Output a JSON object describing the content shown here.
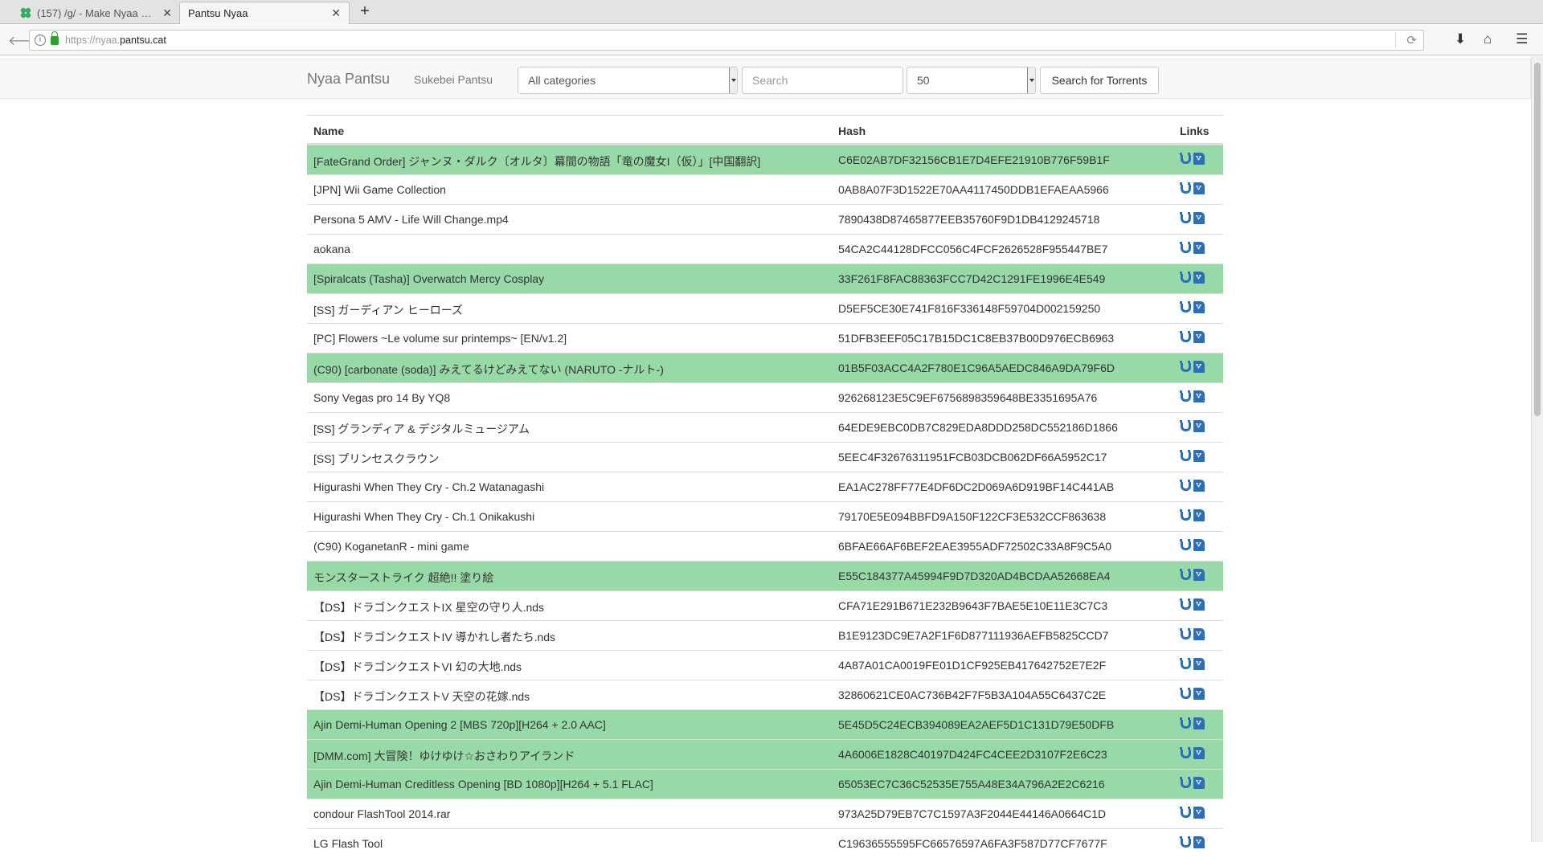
{
  "browser": {
    "tabs": [
      {
        "title": "(157) /g/ - Make Nyaa Great Again",
        "active": false
      },
      {
        "title": "Pantsu Nyaa",
        "active": true
      }
    ],
    "url_scheme": "https://nyaa.",
    "url_host": "pantsu.cat"
  },
  "header": {
    "brand": "Nyaa Pantsu",
    "sukebei_link": "Sukebei Pantsu",
    "category_selected": "All categories",
    "search_placeholder": "Search",
    "per_page_selected": "50",
    "search_button": "Search for Torrents"
  },
  "table": {
    "headers": {
      "name": "Name",
      "hash": "Hash",
      "links": "Links"
    },
    "rows": [
      {
        "name": "[FateGrand Order] ジャンヌ・ダルク〔オルタ〕幕間の物語「竜の魔女I（仮）」[中国翻訳]",
        "hash": "C6E02AB7DF32156CB1E7D4EFE21910B776F59B1F",
        "trusted": true
      },
      {
        "name": "[JPN] Wii Game Collection",
        "hash": "0AB8A07F3D1522E70AA4117450DDB1EFAEAA5966",
        "trusted": false
      },
      {
        "name": "Persona 5 AMV - Life Will Change.mp4",
        "hash": "7890438D87465877EEB35760F9D1DB4129245718",
        "trusted": false
      },
      {
        "name": "aokana",
        "hash": "54CA2C44128DFCC056C4FCF2626528F955447BE7",
        "trusted": false
      },
      {
        "name": "[Spiralcats (Tasha)] Overwatch Mercy Cosplay",
        "hash": "33F261F8FAC88363FCC7D42C1291FE1996E4E549",
        "trusted": true
      },
      {
        "name": "[SS] ガーディアン ヒーローズ",
        "hash": "D5EF5CE30E741F816F336148F59704D002159250",
        "trusted": false
      },
      {
        "name": "[PC] Flowers ~Le volume sur printemps~ [EN/v1.2]",
        "hash": "51DFB3EEF05C17B15DC1C8EB37B00D976ECB6963",
        "trusted": false
      },
      {
        "name": "(C90) [carbonate (soda)] みえてるけどみえてない (NARUTO -ナルト-)",
        "hash": "01B5F03ACC4A2F780E1C96A5AEDC846A9DA79F6D",
        "trusted": true
      },
      {
        "name": "Sony Vegas pro 14 By YQ8",
        "hash": "926268123E5C9EF6756898359648BE3351695A76",
        "trusted": false
      },
      {
        "name": "[SS] グランディア & デジタルミュージアム",
        "hash": "64EDE9EBC0DB7C829EDA8DDD258DC552186D1866",
        "trusted": false
      },
      {
        "name": "[SS] プリンセスクラウン",
        "hash": "5EEC4F32676311951FCB03DCB062DF66A5952C17",
        "trusted": false
      },
      {
        "name": "Higurashi When They Cry - Ch.2 Watanagashi",
        "hash": "EA1AC278FF77E4DF6DC2D069A6D919BF14C441AB",
        "trusted": false
      },
      {
        "name": "Higurashi When They Cry - Ch.1 Onikakushi",
        "hash": "79170E5E094BBFD9A150F122CF3E532CCF863638",
        "trusted": false
      },
      {
        "name": "(C90) KoganetanR - mini game",
        "hash": "6BFAE66AF6BEF2EAE3955ADF72502C33A8F9C5A0",
        "trusted": false
      },
      {
        "name": "モンスターストライク 超絶!! 塗り絵",
        "hash": "E55C184377A45994F9D7D320AD4BCDAA52668EA4",
        "trusted": true
      },
      {
        "name": "【DS】ドラゴンクエストIX 星空の守り人.nds",
        "hash": "CFA71E291B671E232B9643F7BAE5E10E11E3C7C3",
        "trusted": false
      },
      {
        "name": "【DS】ドラゴンクエストIV 導かれし者たち.nds",
        "hash": "B1E9123DC9E7A2F1F6D877111936AEFB5825CCD7",
        "trusted": false
      },
      {
        "name": "【DS】ドラゴンクエストVI 幻の大地.nds",
        "hash": "4A87A01CA0019FE01D1CF925EB417642752E7E2F",
        "trusted": false
      },
      {
        "name": "【DS】ドラゴンクエストV 天空の花嫁.nds",
        "hash": "32860621CE0AC736B42F7F5B3A104A55C6437C2E",
        "trusted": false
      },
      {
        "name": "Ajin Demi-Human Opening 2 [MBS 720p][H264 + 2.0 AAC]",
        "hash": "5E45D5C24ECB394089EA2AEF5D1C131D79E50DFB",
        "trusted": true
      },
      {
        "name": "[DMM.com] 大冒険！ゆけゆけ☆おさわりアイランド",
        "hash": "4A6006E1828C40197D424FC4CEE2D3107F2E6C23",
        "trusted": true
      },
      {
        "name": "Ajin Demi-Human Creditless Opening [BD 1080p][H264 + 5.1 FLAC]",
        "hash": "65053EC7C36C52535E755A48E34A796A2E2C6216",
        "trusted": true
      },
      {
        "name": "condour FlashTool 2014.rar",
        "hash": "973A25D79EB7C7C1597A3F2044E44146A0664C1D",
        "trusted": false
      },
      {
        "name": "LG Flash Tool",
        "hash": "C19636555595FC66576597A6FA3F587D77CF7677F",
        "trusted": false
      }
    ]
  },
  "colors": {
    "trusted_row": "#98d9a8",
    "link_icon": "#2a6fb8"
  }
}
